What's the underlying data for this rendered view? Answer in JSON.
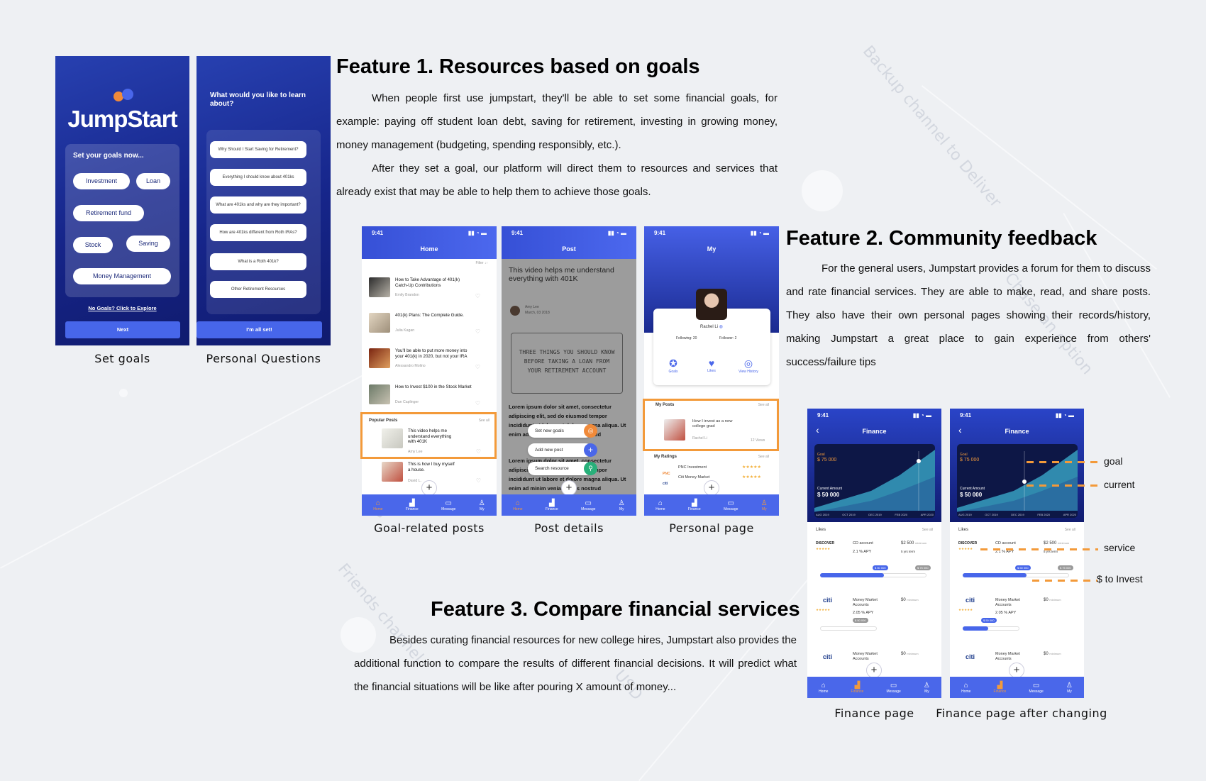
{
  "feature1": {
    "heading": "Feature 1. Resources based on goals",
    "paragraphs": [
      "When people first use jumpstart, they'll be able to set some financial goals, for example: paying off student loan debt, saving for retirement, investing in growing money, money management (budgeting, spending responsibly, etc.).",
      "After they set a goal, our platform will direct them to resources and services that already exist that may be able to help them to achieve those goals."
    ]
  },
  "feature2": {
    "heading": "Feature 2. Community feedback",
    "paragraphs": [
      "For the general users, Jumpstart provides a forum for them to discuss and rate financial services. They are able to make, read, and share posts. They also have their own personal pages showing their records/history, making Jumpstart a great place to gain experience from others' success/failure tips"
    ]
  },
  "feature3": {
    "heading": "Feature 3. Compare financial services",
    "paragraphs": [
      "Besides curating financial resources for new college hires, Jumpstart also provides the additional function to compare the results of different financial decisions. It will predict what the financial situations will be like after pouring X amount of money..."
    ]
  },
  "captions": {
    "set_goals": "Set goals",
    "personal_questions": "Personal Questions",
    "goal_posts": "Goal-related posts",
    "post_details": "Post details",
    "personal_page": "Personal page",
    "finance_page": "Finance page",
    "finance_after": "Finance page after changing"
  },
  "annotations": {
    "goal": "goal",
    "current": "current",
    "service": "service",
    "to_invest": "$ to Invest"
  },
  "status_time": "9:41",
  "setgoals": {
    "logo": "JumpStart",
    "prompt": "Set your goals now...",
    "goals": [
      "Investment",
      "Loan",
      "Retirement fund",
      "Stock",
      "Saving",
      "Money Management"
    ],
    "explore_link": "No Goals? Click to Explore",
    "next": "Next"
  },
  "questions": {
    "title": "What would you like to learn about?",
    "items": [
      "Why Should I Start Saving for Retirement?",
      "Everything I should know about 401ks",
      "What are 401ks and why are they important?",
      "How are 401ks different from Roth IRAs?",
      "What is a Roth 401k?",
      "Other Retirement Resources"
    ],
    "done": "I'm all set!"
  },
  "home": {
    "title": "Home",
    "filter": "Filter",
    "posts": [
      {
        "title": "How to Take Advantage of 401(k) Catch-Up Contributions",
        "author": "Emily Brandon"
      },
      {
        "title": "401(k) Plans: The Complete Guide.",
        "author": "Julia Kagan"
      },
      {
        "title": "You'll be able to put more money into your 401(k) in 2020, but not your IRA",
        "author": "Alessandro Molino"
      },
      {
        "title": "How to Invest $100 in the Stock Market",
        "author": "Dan Caplinger"
      }
    ],
    "popular_label": "Popular Posts",
    "see_all": "See all",
    "popular": [
      {
        "title": "This video helps me understand everything with 401K",
        "author": "Amy Lee"
      },
      {
        "title": "This is how I buy myself a house.",
        "author": "David L."
      }
    ]
  },
  "post": {
    "title": "Post",
    "headline": "This video helps me understand everything with 401K",
    "author": "Amy Lee",
    "date": "March, 03 2018",
    "video_text": "THREE THINGS YOU SHOULD KNOW BEFORE TAKING A LOAN FROM YOUR RETIREMENT ACCOUNT",
    "body1": "Lorem ipsum dolor sit amet, consectetur adipiscing elit, sed do eiusmod tempor incididunt ut labore et dolore magna aliqua. Ut enim ad minim veniam, quis nostrud",
    "body2": "Lorem ipsum dolor sit amet, consectetur adipiscing elit, sed do eiusmod tempor incididunt ut labore et dolore magna aliqua. Ut enim ad minim veniam, quis nostrud",
    "menu": [
      "Set new goals",
      "Add new post",
      "Search resource"
    ]
  },
  "my": {
    "title": "My",
    "name": "Rachel Li",
    "following": "Following: 20",
    "follower": "Follower: 2",
    "tabs": [
      "Goals",
      "Likes",
      "View History"
    ],
    "my_posts": "My Posts",
    "see_all": "See all",
    "post_title": "How I invest as a new college grad",
    "post_author": "Rachel Li",
    "post_views": "12 Views",
    "ratings": "My Ratings",
    "rating_items": [
      {
        "logo": "PNC",
        "name": "PNC Investment"
      },
      {
        "logo": "citi",
        "name": "Citi Money Market"
      }
    ]
  },
  "nav": [
    "Home",
    "Finance",
    "Message",
    "My"
  ],
  "finance": {
    "title": "Finance",
    "goal_label": "Goal",
    "goal_value": "$ 75 000",
    "current_label": "Current Amount",
    "current_value": "$ 50 000",
    "axis": [
      "AUG 2019",
      "OCT 2019",
      "DEC 2019",
      "FEB 2020",
      "APR 2020"
    ],
    "likes": "Likes",
    "see_all": "See all",
    "services": [
      {
        "logo": "DISCOVER",
        "name": "CD account",
        "rate": "2.1 % APY",
        "min": "$2 500",
        "min_label": "minimum",
        "term": "5 yrs term",
        "amount": "$ 50 000",
        "max": "$ 75 000",
        "progress": 0.6
      },
      {
        "logo": "citi",
        "name": "Money Market Accounts",
        "rate": "2.05 % APY",
        "min": "$0",
        "min_label": "minimum",
        "amount": "$ 50 000",
        "progress": 0.0,
        "progress_after": 0.45
      },
      {
        "logo": "citi",
        "name": "Money Market Accounts",
        "min": "$0",
        "min_label": "minimum"
      }
    ]
  }
}
